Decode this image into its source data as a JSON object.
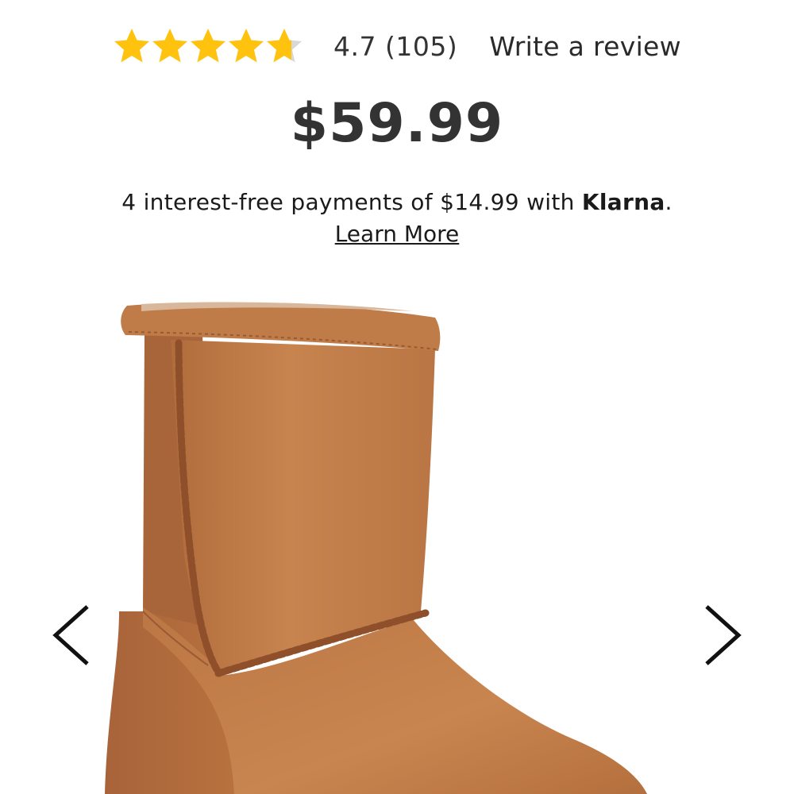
{
  "rating": {
    "value": 4.7,
    "max": 5,
    "text": "4.7 (105)",
    "write_review": "Write a review",
    "star_color": "#ffc20e",
    "star_empty_color": "#d8d8d8"
  },
  "price": "$59.99",
  "klarna": {
    "prefix": "4 interest-free payments of $14.99 with ",
    "brand": "Klarna",
    "suffix": ".",
    "learn_more": "Learn More"
  },
  "gallery": {
    "image": "product-boot-image",
    "prev_icon": "chevron-left-icon",
    "next_icon": "chevron-right-icon",
    "boot_color": "#c07a46"
  }
}
